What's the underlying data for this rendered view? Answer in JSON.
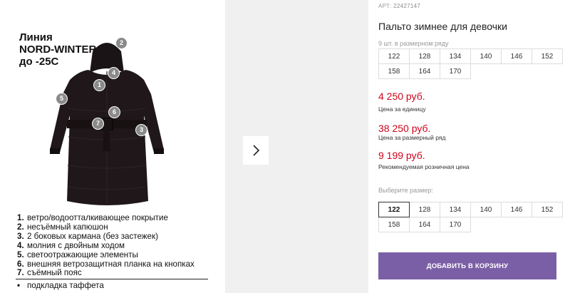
{
  "image_panel": {
    "line_title": [
      "Линия",
      "NORD-WINTER",
      "до -25C"
    ],
    "markers": [
      "1",
      "2",
      "3",
      "4",
      "5",
      "6",
      "7"
    ],
    "features": [
      {
        "num": "1.",
        "text": "ветро/водоотталкивающее покрытие"
      },
      {
        "num": "2.",
        "text": "несъёмный капюшон"
      },
      {
        "num": "3.",
        "text": "2 боковых кармана (без застежек)"
      },
      {
        "num": "4.",
        "text": "молния с двойным ходом"
      },
      {
        "num": "5.",
        "text": "светоотражающие элементы"
      },
      {
        "num": "6.",
        "text": "внешняя ветрозащитная планка на кнопках"
      },
      {
        "num": "7.",
        "text": "съёмный пояс"
      }
    ],
    "lining": {
      "bullet": "•",
      "text": "подкладка таффета"
    }
  },
  "gallery": {
    "next_icon": "chevron-right-icon"
  },
  "product": {
    "art_label": "АРТ:",
    "art_number": "22427147",
    "title": "Пальто зимнее для девочки",
    "pack_note": "9 шт. в размерном ряду",
    "pack_sizes": [
      [
        "122",
        "128",
        "134",
        "140",
        "146",
        "152"
      ],
      [
        "158",
        "164",
        "170"
      ]
    ],
    "prices": [
      {
        "value": "4 250 руб.",
        "label": "Цена за единицу"
      },
      {
        "value": "38 250 руб.",
        "label": "Цена за размерный ряд"
      },
      {
        "value": "9 199 руб.",
        "label": "Рекомендуемая розничная цена"
      }
    ],
    "choose_label": "Выберите размер:",
    "choose_sizes": [
      [
        "122",
        "128",
        "134",
        "140",
        "146",
        "152"
      ],
      [
        "158",
        "164",
        "170"
      ]
    ],
    "selected_size": "122",
    "add_to_cart": "ДОБАВИТЬ В КОРЗИНУ"
  },
  "colors": {
    "price_red": "#d0021b",
    "button_purple": "#7b5fa6",
    "gallery_bg": "#f0f0f0"
  }
}
